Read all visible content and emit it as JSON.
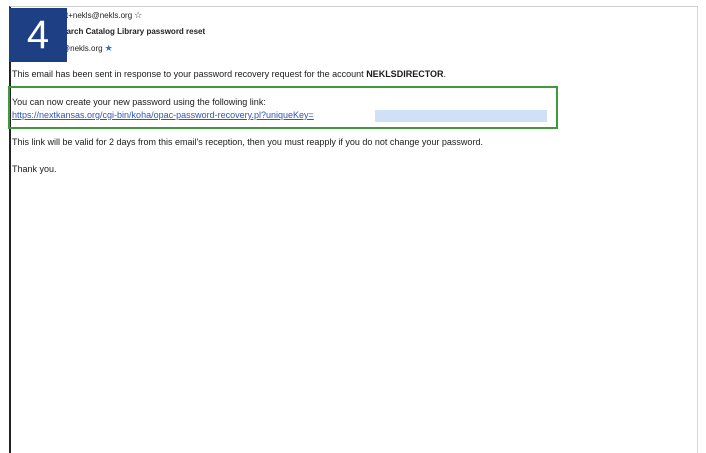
{
  "step": {
    "number": "4"
  },
  "email": {
    "from": "xt+nekls@nekls.org",
    "subject": "earch Catalog Library password reset",
    "to": "@nekls.org"
  },
  "icons": {
    "star_outline": "star-outline-icon",
    "star_filled": "star-filled-icon"
  },
  "body": {
    "line1_prefix": "This email has been sent in response to your password recovery request for the account ",
    "account": "NEKLSDIRECTOR",
    "line1_suffix": ".",
    "line2": "You can now create your new password using the following link:",
    "link": "https://nextkansas.org/cgi-bin/koha/opac-password-recovery.pl?uniqueKey=",
    "line3": "This link will be valid for 2 days from this email's reception, then you must reapply if you do not change your password.",
    "line4": "Thank you."
  },
  "colors": {
    "badge": "#1f3f85",
    "highlight": "#3d9a3d",
    "link": "#2b57b8",
    "redaction": "#cfe0f7"
  }
}
